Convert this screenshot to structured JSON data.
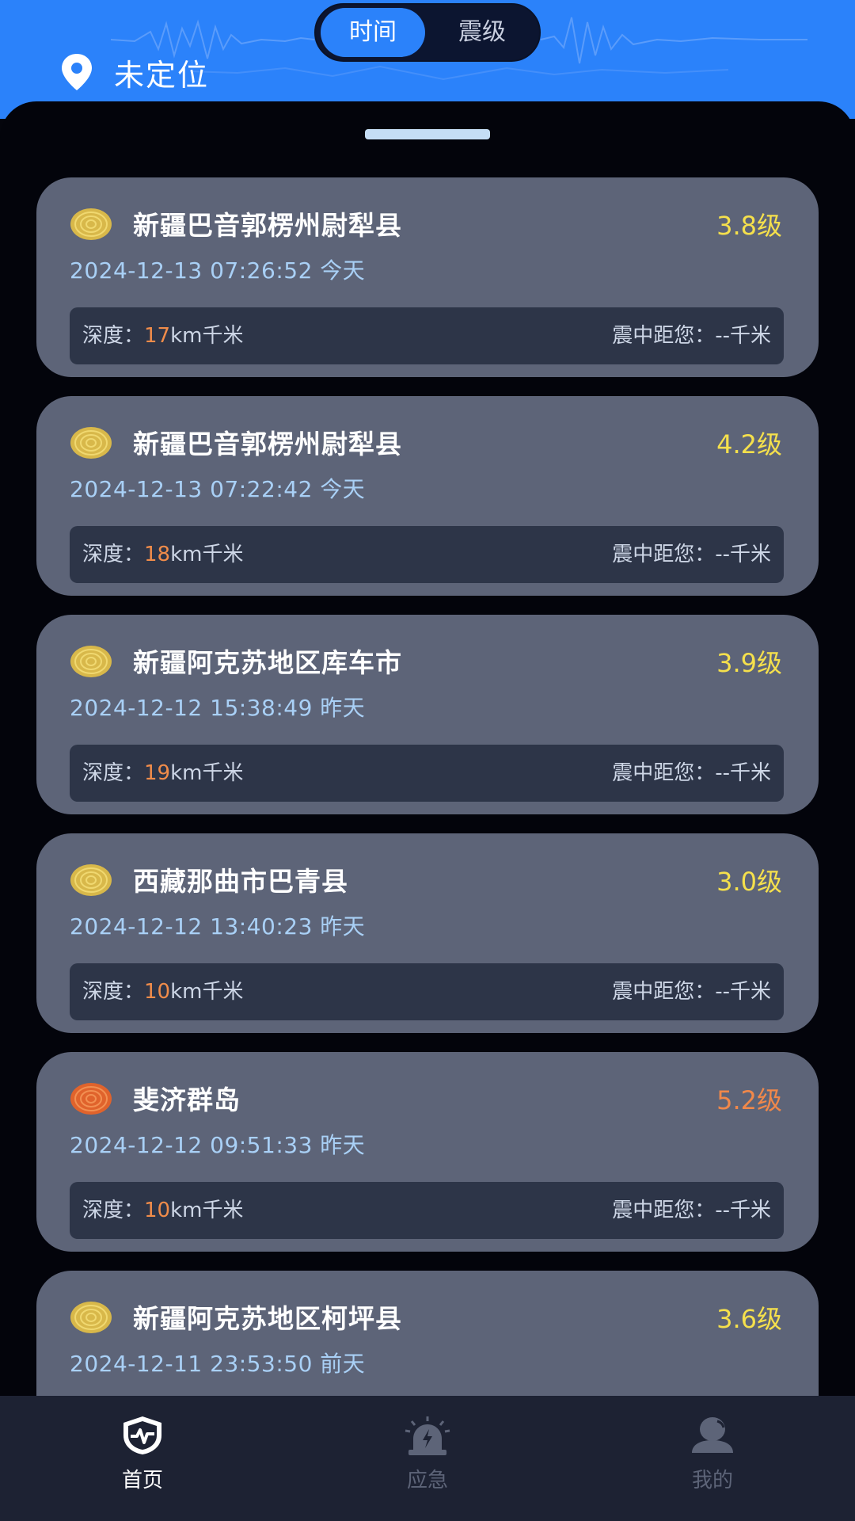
{
  "header": {
    "tabs": [
      {
        "label": "时间",
        "active": true
      },
      {
        "label": "震级",
        "active": false
      }
    ],
    "location_label": "未定位"
  },
  "colors": {
    "accent": "#2b82fa",
    "card_bg": "#5d6478",
    "info_bg": "#2d3548",
    "time_text": "#a9d0f6",
    "magnitude_yellow": "#f5e04c",
    "magnitude_orange": "#f0884a"
  },
  "labels": {
    "depth_prefix": "深度：",
    "depth_unit": "km千米",
    "distance_label": "震中距您：--千米"
  },
  "events": [
    {
      "place": "新疆巴音郭楞州尉犁县",
      "magnitude": "3.8级",
      "time": "2024-12-13 07:26:52 今天",
      "depth": "17",
      "level": "yellow"
    },
    {
      "place": "新疆巴音郭楞州尉犁县",
      "magnitude": "4.2级",
      "time": "2024-12-13 07:22:42 今天",
      "depth": "18",
      "level": "yellow"
    },
    {
      "place": "新疆阿克苏地区库车市",
      "magnitude": "3.9级",
      "time": "2024-12-12 15:38:49 昨天",
      "depth": "19",
      "level": "yellow"
    },
    {
      "place": "西藏那曲市巴青县",
      "magnitude": "3.0级",
      "time": "2024-12-12 13:40:23 昨天",
      "depth": "10",
      "level": "yellow"
    },
    {
      "place": "斐济群岛",
      "magnitude": "5.2级",
      "time": "2024-12-12 09:51:33 昨天",
      "depth": "10",
      "level": "orange"
    },
    {
      "place": "新疆阿克苏地区柯坪县",
      "magnitude": "3.6级",
      "time": "2024-12-11 23:53:50 前天",
      "depth": "",
      "level": "yellow"
    }
  ],
  "nav": [
    {
      "label": "首页",
      "icon": "shield-pulse-icon",
      "active": true
    },
    {
      "label": "应急",
      "icon": "alarm-siren-icon",
      "active": false
    },
    {
      "label": "我的",
      "icon": "user-icon",
      "active": false
    }
  ]
}
